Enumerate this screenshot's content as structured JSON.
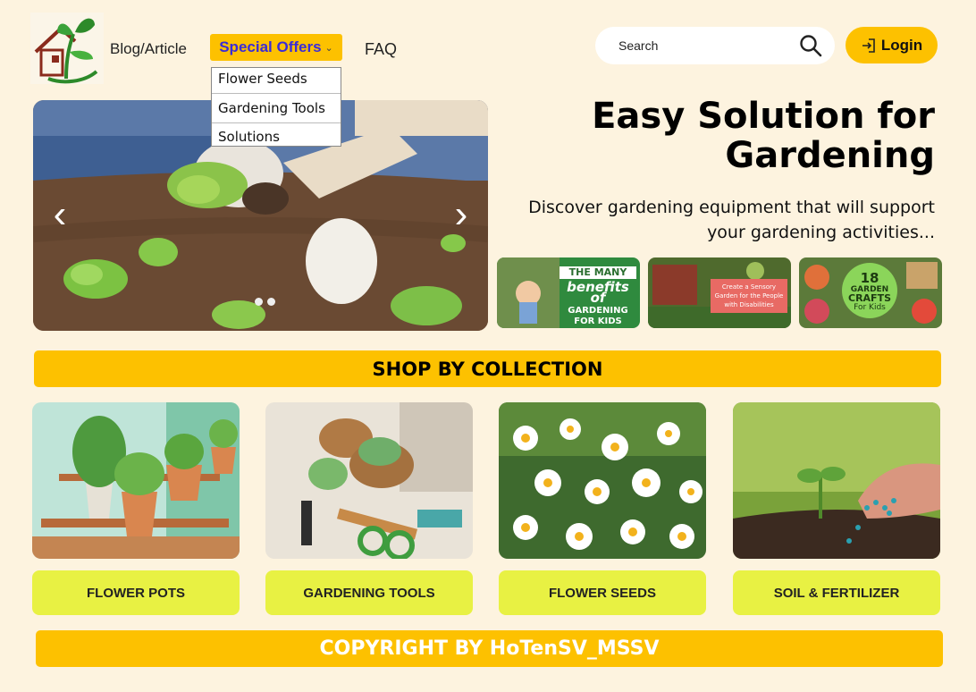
{
  "header": {
    "logo_icon": "house-plant-logo-icon",
    "nav": {
      "blog_label": "Blog/Article",
      "special_offers_label": "Special Offers",
      "faq_label": "FAQ"
    },
    "special_offers_menu": [
      "Flower Seeds",
      "Gardening Tools",
      "Solutions"
    ],
    "search": {
      "placeholder": "Search",
      "icon": "search-icon"
    },
    "login_label": "Login",
    "login_icon": "login-arrow-icon"
  },
  "hero": {
    "title_line1": "Easy Solution for",
    "title_line2": "Gardening",
    "subtitle_line1": "Discover gardening equipment that will support",
    "subtitle_line2": "your gardening activities...",
    "slider": {
      "prev_icon": "chevron-left-icon",
      "next_icon": "chevron-right-icon",
      "dot_count": 2
    },
    "thumbnails": [
      {
        "top": "THE MANY",
        "mid": "benefits of",
        "bottom": "GARDENING FOR KIDS"
      },
      {
        "text": "Create a Sensory Garden for the People with Disabilities"
      },
      {
        "num": "18",
        "line1": "GARDEN",
        "line2": "CRAFTS",
        "line3": "For Kids"
      }
    ]
  },
  "collection": {
    "heading": "SHOP BY COLLECTION",
    "items": [
      {
        "label": "FLOWER POTS"
      },
      {
        "label": "GARDENING TOOLS"
      },
      {
        "label": "FLOWER SEEDS"
      },
      {
        "label": "SOIL & FERTILIZER"
      }
    ]
  },
  "footer": {
    "copyright": "COPYRIGHT BY HoTenSV_MSSV"
  },
  "colors": {
    "background": "#fdf3df",
    "accent": "#fdc100",
    "button_lime": "#e8f143",
    "link_blue": "#3a2bd8"
  }
}
